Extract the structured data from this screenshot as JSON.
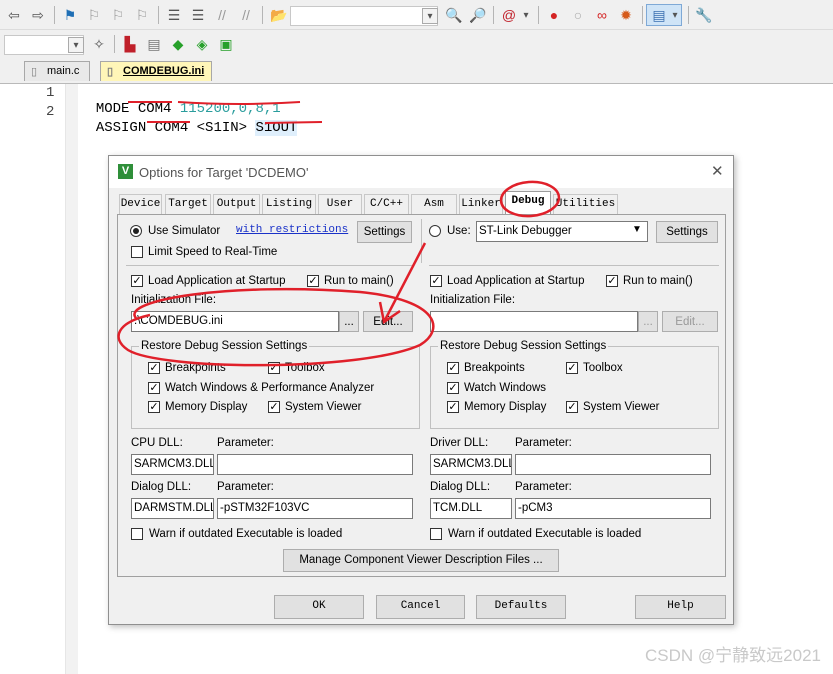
{
  "toolbar1_icons": [
    "back-arrow-icon",
    "forward-arrow-icon",
    "bookmark-flag-icon",
    "bookmark-prev-icon",
    "bookmark-next-icon",
    "bookmark-clear-icon",
    "indent-icon",
    "unindent-icon",
    "comment-icon",
    "uncomment-icon",
    "open-file-icon",
    "target-dropdown-icon",
    "find-in-files-icon",
    "incremental-find-icon",
    "debug-session-icon",
    "breakpoint-insert-icon",
    "breakpoint-disable-icon",
    "breakpoint-disable-all-icon",
    "breakpoint-kill-icon",
    "window-layout-icon",
    "configure-icon"
  ],
  "toolbar2_icons": [
    "target-dropdown-icon",
    "magic-wand-icon",
    "load-icon",
    "manage-project-icon",
    "green-diamond-icon",
    "build-icon",
    "pack-installer-icon"
  ],
  "file_tabs": [
    {
      "label": "main.c",
      "active": false
    },
    {
      "label": "COMDEBUG.ini",
      "active": true
    }
  ],
  "code_lines": [
    {
      "num": "1",
      "tokens": [
        {
          "t": "MODE ",
          "c": "#000"
        },
        {
          "t": "COM4",
          "c": "#000"
        },
        {
          "t": " ",
          "c": "#000"
        },
        {
          "t": "115200,0,8,1",
          "c": "#2a9d9d"
        }
      ]
    },
    {
      "num": "2",
      "tokens": [
        {
          "t": "ASSIGN ",
          "c": "#000"
        },
        {
          "t": "COM4",
          "c": "#000"
        },
        {
          "t": " <S1IN> ",
          "c": "#000"
        },
        {
          "t": "S1OUT",
          "c": "#000"
        }
      ]
    }
  ],
  "dialog": {
    "title": "Options for Target 'DCDEMO'",
    "close": "✕",
    "tabs": [
      "Device",
      "Target",
      "Output",
      "Listing",
      "User",
      "C/C++",
      "Asm",
      "Linker",
      "Debug",
      "Utilities"
    ],
    "active_tab": "Debug",
    "left": {
      "use_simulator": "Use Simulator",
      "restrictions_link": "with restrictions",
      "settings": "Settings",
      "limit_speed": "Limit Speed to Real-Time",
      "load_app": "Load Application at Startup",
      "run_to_main": "Run to main()",
      "init_file_label": "Initialization File:",
      "init_file_value": ".\\COMDEBUG.ini",
      "browse": "...",
      "edit": "Edit...",
      "restore_group": "Restore Debug Session Settings",
      "breakpoints": "Breakpoints",
      "toolbox": "Toolbox",
      "watch_windows": "Watch Windows & Performance Analyzer",
      "memory_display": "Memory Display",
      "system_viewer": "System Viewer",
      "dll_label": "CPU DLL:",
      "dll_param_label": "Parameter:",
      "dll_value": "SARMCM3.DLL",
      "dll_param_value": "",
      "dialog_dll_label": "Dialog DLL:",
      "dialog_param_label": "Parameter:",
      "dialog_dll_value": "DARMSTM.DLL",
      "dialog_param_value": "-pSTM32F103VC",
      "warn": "Warn if outdated Executable is loaded"
    },
    "right": {
      "use_label": "Use:",
      "debugger": "ST-Link Debugger",
      "settings": "Settings",
      "load_app": "Load Application at Startup",
      "run_to_main": "Run to main()",
      "init_file_label": "Initialization File:",
      "init_file_value": "",
      "browse": "...",
      "edit": "Edit...",
      "restore_group": "Restore Debug Session Settings",
      "breakpoints": "Breakpoints",
      "toolbox": "Toolbox",
      "watch_windows": "Watch Windows",
      "memory_display": "Memory Display",
      "system_viewer": "System Viewer",
      "dll_label": "Driver DLL:",
      "dll_param_label": "Parameter:",
      "dll_value": "SARMCM3.DLL",
      "dll_param_value": "",
      "dialog_dll_label": "Dialog DLL:",
      "dialog_param_label": "Parameter:",
      "dialog_dll_value": "TCM.DLL",
      "dialog_param_value": "-pCM3",
      "warn": "Warn if outdated Executable is loaded"
    },
    "manage_button": "Manage Component Viewer Description Files ...",
    "ok": "OK",
    "cancel": "Cancel",
    "defaults": "Defaults",
    "help": "Help"
  },
  "watermark": "CSDN @宁静致远2021",
  "colors": {
    "annotation_red": "#e0202a",
    "active_tab_yellow": "#fff6b8",
    "link_blue": "#1a32c8"
  }
}
